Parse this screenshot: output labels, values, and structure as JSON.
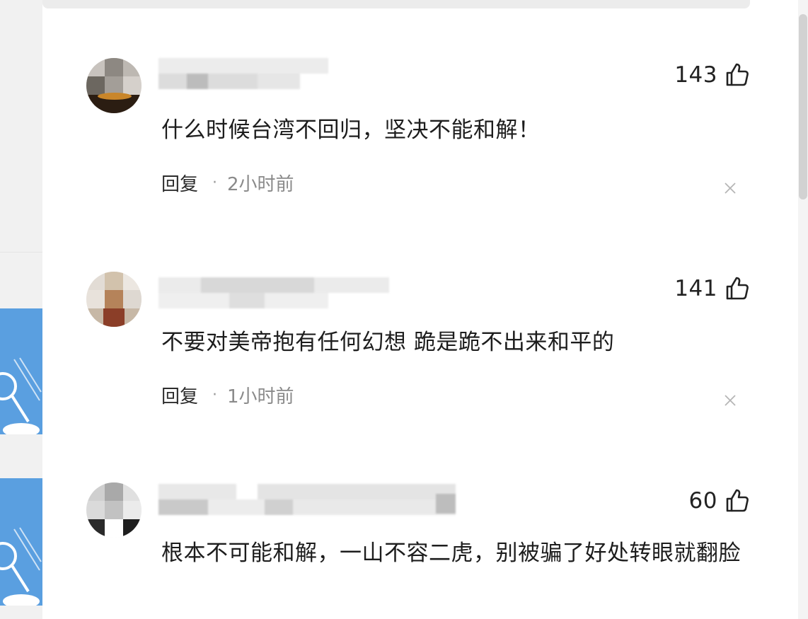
{
  "comments": [
    {
      "likes": "143",
      "text": "什么时候台湾不回归，坚决不能和解！",
      "reply_label": "回复",
      "separator": "·",
      "time": "2小时前"
    },
    {
      "likes": "141",
      "text": "不要对美帝抱有任何幻想 跪是跪不出来和平的",
      "reply_label": "回复",
      "separator": "·",
      "time": "1小时前"
    },
    {
      "likes": "60",
      "text": "根本不可能和解，一山不容二虎，别被骗了好处转眼就翻脸"
    }
  ],
  "icons": {
    "like": "thumbs-up-icon",
    "close": "close-icon"
  },
  "colors": {
    "text": "#1d1d1d",
    "muted": "#8a8a8a",
    "thumbnail_blue": "#5a9fe0"
  }
}
